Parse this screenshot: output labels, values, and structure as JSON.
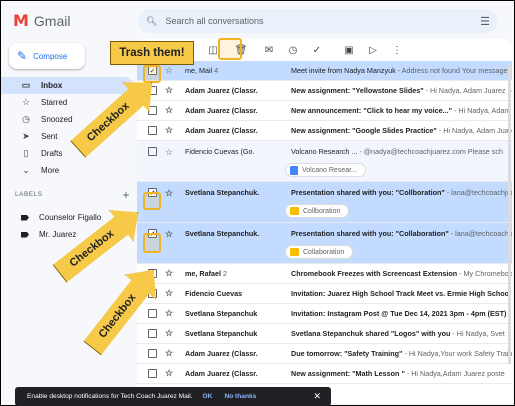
{
  "app": {
    "logo_text": "Gmail"
  },
  "search": {
    "placeholder": "Search all conversations"
  },
  "compose_label": "Compose",
  "nav": [
    {
      "label": "Inbox",
      "icon": "inbox-icon",
      "glyph": "▭",
      "active": true
    },
    {
      "label": "Starred",
      "icon": "star-icon",
      "glyph": "☆"
    },
    {
      "label": "Snoozed",
      "icon": "clock-icon",
      "glyph": "◷"
    },
    {
      "label": "Sent",
      "icon": "send-icon",
      "glyph": "➤"
    },
    {
      "label": "Drafts",
      "icon": "draft-icon",
      "glyph": "▯"
    },
    {
      "label": "More",
      "icon": "chevron-down-icon",
      "glyph": "⌄"
    }
  ],
  "labels": {
    "heading": "LABELS",
    "items": [
      "Counselor Figallo",
      "Mr. Juarez"
    ]
  },
  "emails": [
    {
      "sender": "me, Mail",
      "count": "4",
      "subject": "Meet invite from Nadya Manzyuk",
      "snippet": " - Address not found Your message",
      "selected": true,
      "unread": false
    },
    {
      "sender": "Adam Juarez (Classr.",
      "count": "",
      "subject": "New assignment: \"Yellowstone Slides\"",
      "snippet": " - Hi Nadya, Adam Juarez posted",
      "selected": false,
      "unread": true
    },
    {
      "sender": "Adam Juarez (Classr.",
      "count": "",
      "subject": "New announcement: \"Click to hear my voice...\"",
      "snippet": " - Hi Nadya, Adam Juarez",
      "selected": false,
      "unread": true
    },
    {
      "sender": "Adam Juarez (Classr.",
      "count": "",
      "subject": "New assignment: \"Google Slides Practice\"",
      "snippet": " - Hi Nadya, Adam Juarez post",
      "selected": false,
      "unread": true
    },
    {
      "sender": "Fidencio Cuevas (Go.",
      "count": "",
      "subject": "Volcano Research ...",
      "snippet": " - @nadya@techcoachjuarez.com Please sch",
      "selected": false,
      "unread": false,
      "attachment": "Volcano Resear...",
      "attachment_type": "doc"
    },
    {
      "sender": "Svetlana Stepanchuk.",
      "count": "",
      "subject": "Presentation shared with you: \"Collboration\"",
      "snippet": " - lana@techcoachjuarez.com",
      "selected": true,
      "unread": true,
      "attachment": "Collboration",
      "attachment_type": "slides"
    },
    {
      "sender": "Svetlana Stepanchuk.",
      "count": "",
      "subject": "Presentation shared with you: \"Collaboration\"",
      "snippet": " - lana@techcoachjuarez.com",
      "selected": true,
      "unread": true,
      "attachment": "Collaboration",
      "attachment_type": "slides"
    },
    {
      "sender": "me, Rafael",
      "count": "2",
      "subject": "Chromebook Freezes with Screencast Extension",
      "snippet": " - My Chromebook",
      "selected": false,
      "unread": true
    },
    {
      "sender": "Fidencio Cuevas",
      "count": "",
      "subject": "Invitation: Juarez High School Track Meet vs. Ermie High School (",
      "snippet": "",
      "selected": false,
      "unread": true
    },
    {
      "sender": "Svetlana Stepanchuk",
      "count": "",
      "subject": "Invitation: Instagram Post @ Tue Dec 14, 2021 3pm - 4pm (EST) (",
      "snippet": "",
      "selected": false,
      "unread": true
    },
    {
      "sender": "Svetlana Stepanchuk",
      "count": "",
      "subject": "Svetlana Stepanchuk shared \"Logos\" with you",
      "snippet": " - Hi Nadya, Svet",
      "selected": false,
      "unread": true
    },
    {
      "sender": "Adam Juarez (Classr.",
      "count": "",
      "subject": "Due tomorrow: \"Safety Training\"",
      "snippet": " - Hi Nadya,Your work Safety Traini",
      "selected": false,
      "unread": true
    },
    {
      "sender": "Adam Juarez (Classr.",
      "count": "",
      "subject": "New assignment: \"Math Lesson \"",
      "snippet": " - Hi Nadya,Adam Juarez poste",
      "selected": false,
      "unread": true
    }
  ],
  "snackbar": {
    "message": "Enable desktop notifications for Tech Coach Juarez Mail.",
    "ok": "OK",
    "no_thanks": "No thanks"
  },
  "annotations": {
    "trash": "Trash them!",
    "checkbox": "Checkbox"
  },
  "colors": {
    "accent": "#1a73e8",
    "selected_row": "#c2dbff",
    "callout": "#f7c948"
  }
}
